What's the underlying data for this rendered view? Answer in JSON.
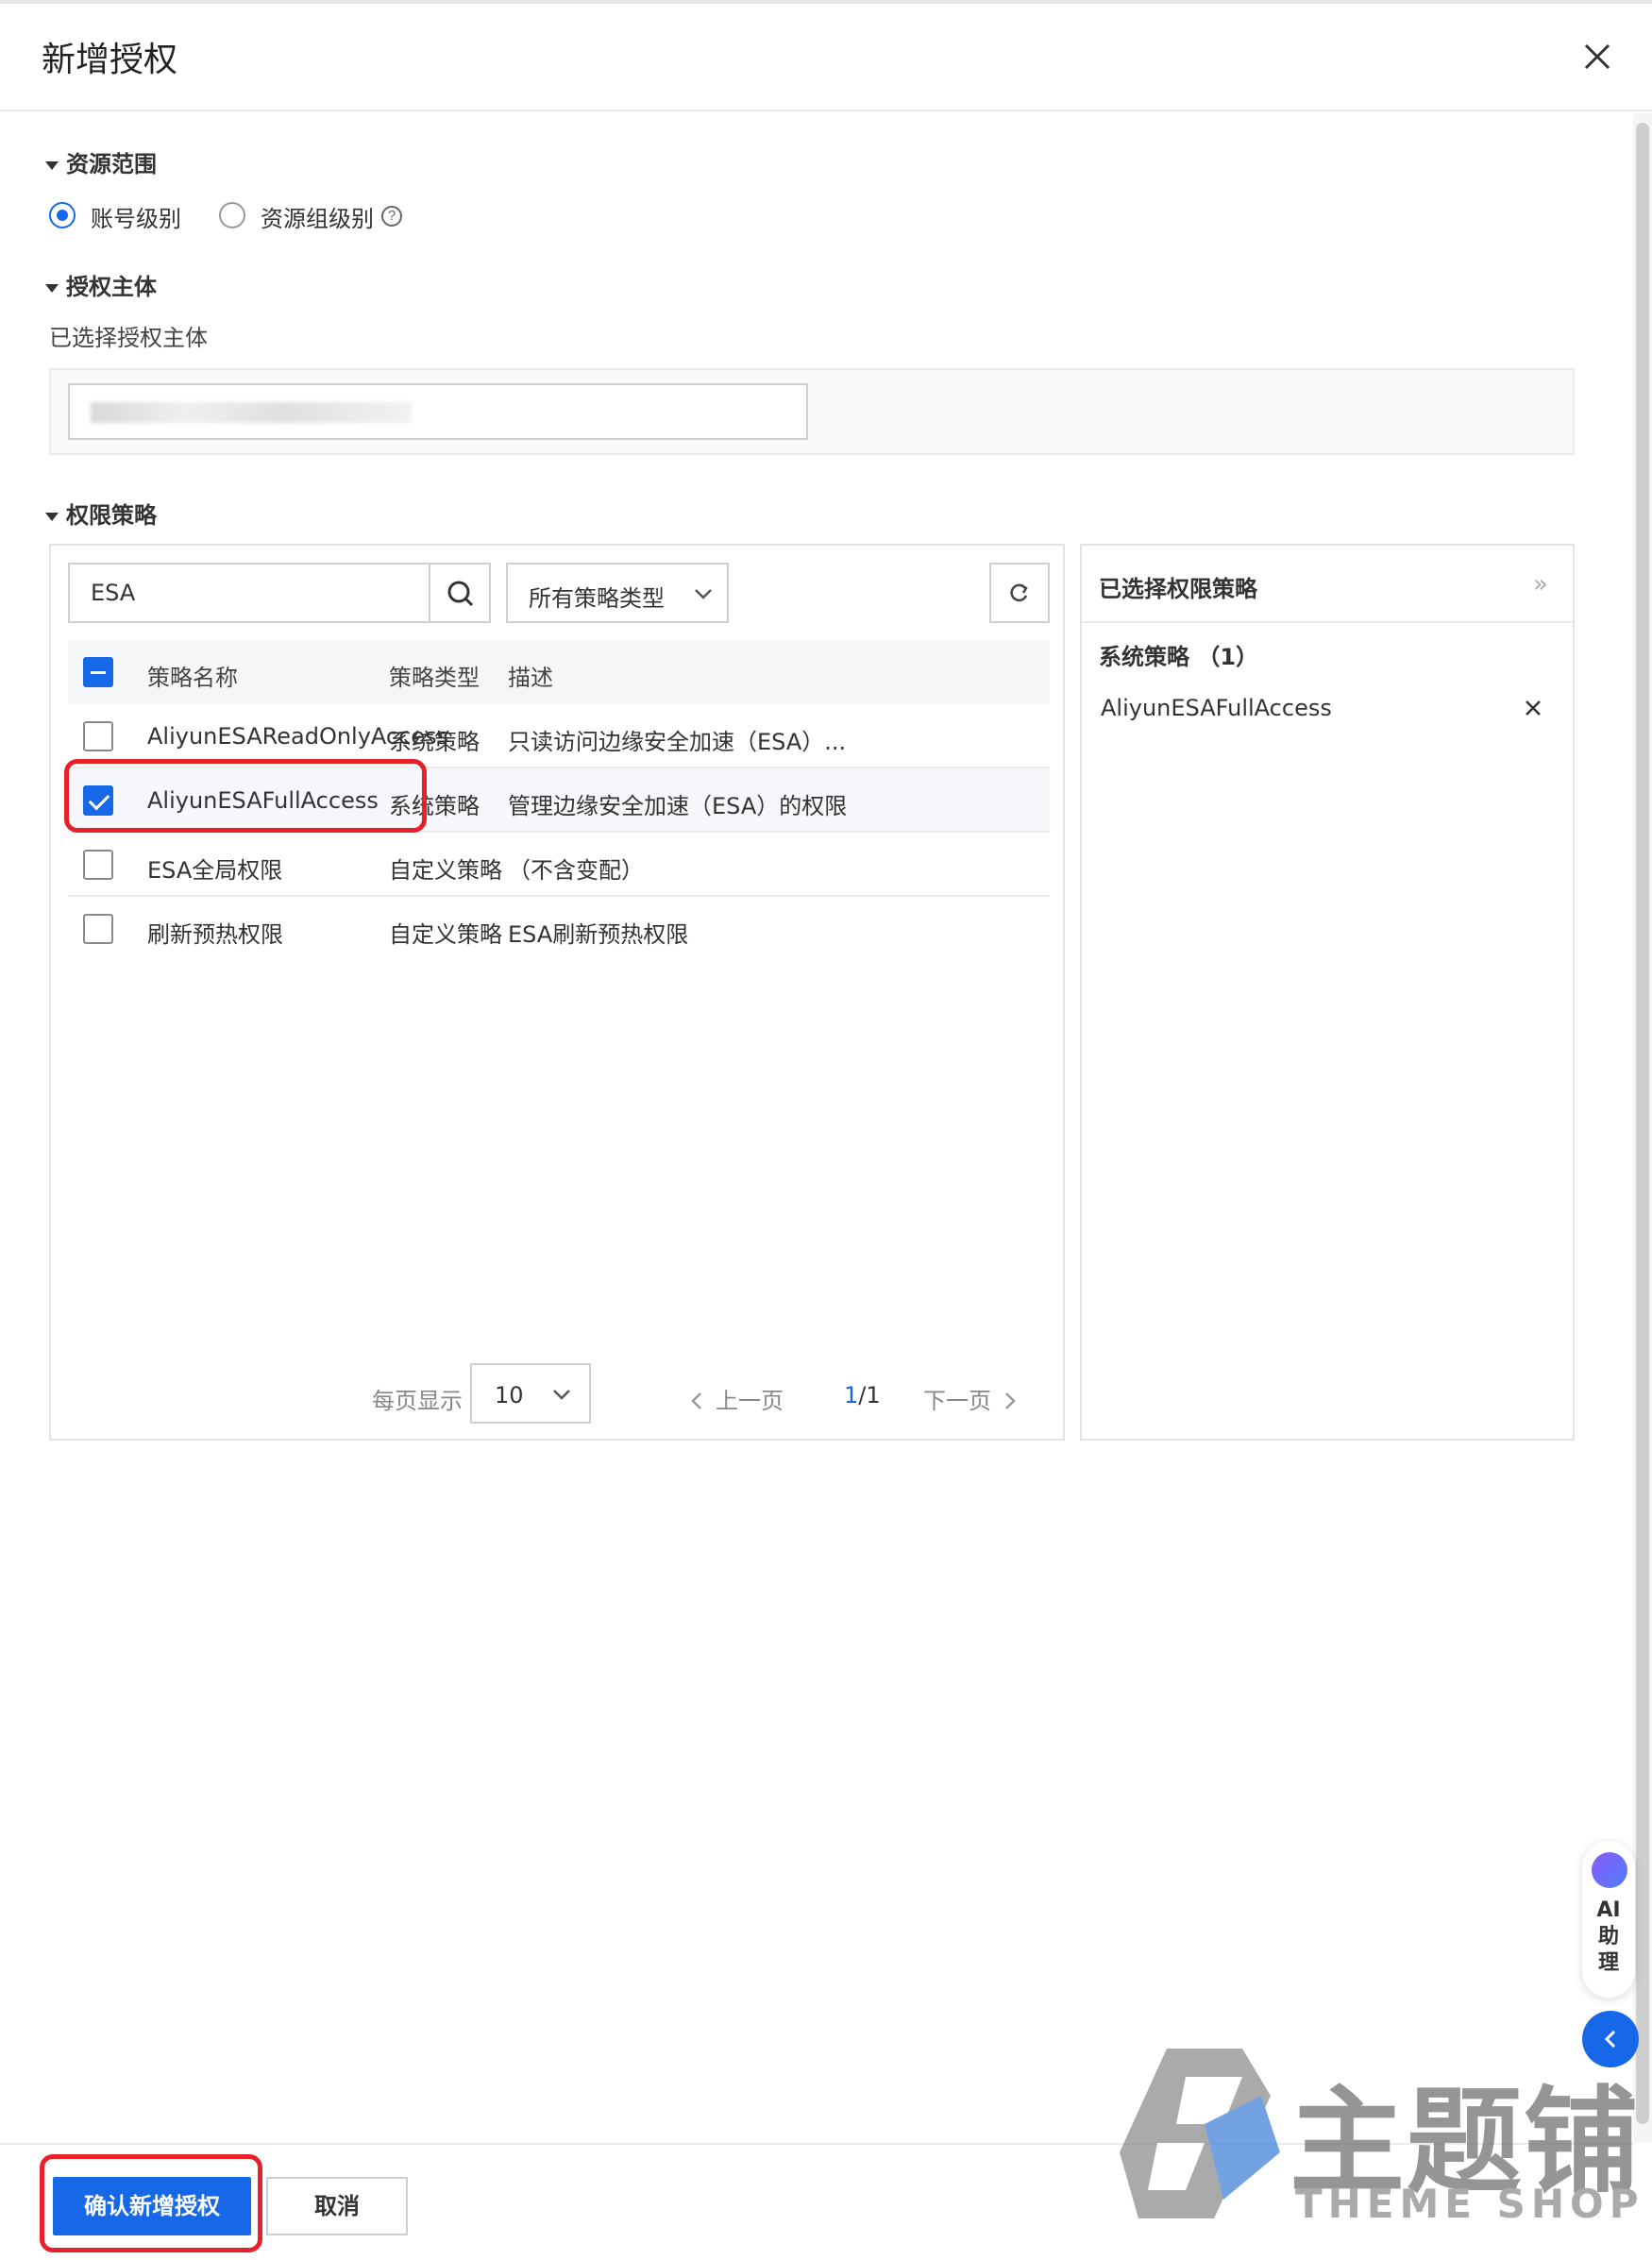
{
  "dialog": {
    "title": "新增授权"
  },
  "resource_scope": {
    "heading": "资源范围",
    "options": [
      {
        "label": "账号级别",
        "selected": true
      },
      {
        "label": "资源组级别",
        "selected": false
      }
    ],
    "help_icon": "question-circle-icon"
  },
  "principal": {
    "heading": "授权主体",
    "selected_label": "已选择授权主体"
  },
  "policies": {
    "heading": "权限策略",
    "search_value": "ESA",
    "type_filter": "所有策略类型",
    "columns": [
      "策略名称",
      "策略类型",
      "描述"
    ],
    "rows": [
      {
        "name": "AliyunESAReadOnlyAccess",
        "type": "系统策略",
        "desc": "只读访问边缘安全加速（ESA）...",
        "checked": false
      },
      {
        "name": "AliyunESAFullAccess",
        "type": "系统策略",
        "desc": "管理边缘安全加速（ESA）的权限",
        "checked": true
      },
      {
        "name": "ESA全局权限",
        "type": "自定义策略",
        "desc": "（不含变配）",
        "checked": false
      },
      {
        "name": "刷新预热权限",
        "type": "自定义策略",
        "desc": "ESA刷新预热权限",
        "checked": false
      }
    ],
    "pager": {
      "page_size_label": "每页显示",
      "page_size": "10",
      "prev": "上一页",
      "current_page": "1",
      "page_sep_total": "/1",
      "next": "下一页"
    }
  },
  "selected_policies": {
    "title": "已选择权限策略",
    "group_label": "系统策略 （1）",
    "items": [
      "AliyunESAFullAccess"
    ]
  },
  "footer": {
    "confirm": "确认新增授权",
    "cancel": "取消"
  },
  "ai_assistant": {
    "label": "AI助理"
  },
  "watermark": {
    "cn": "主题铺",
    "en": "THEME SHOP"
  },
  "colors": {
    "primary": "#1768e8",
    "highlight": "#e8202a"
  }
}
